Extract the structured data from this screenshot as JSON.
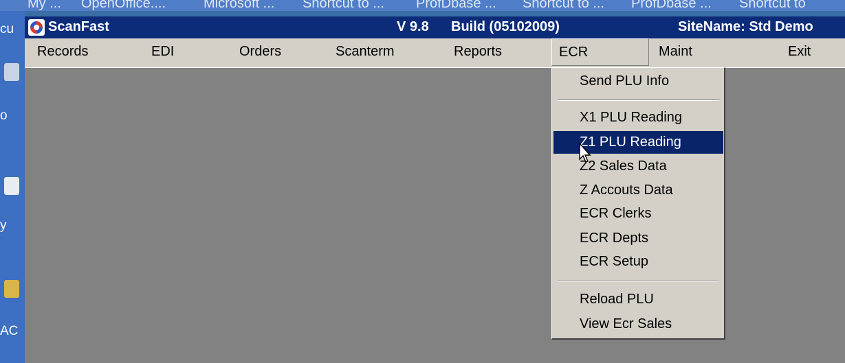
{
  "desktop": {
    "top_labels": [
      "My ...",
      "OpenOffice....",
      "Microsoft ...",
      "Shortcut to ...",
      "ProfDbase ...",
      "Shortcut to ...",
      "ProfDbase ...",
      "Shortcut to"
    ],
    "left_labels": [
      "cu",
      "o",
      "y",
      "AC"
    ]
  },
  "window": {
    "app_title": "ScanFast",
    "version": "V 9.8",
    "build": "Build (05102009)",
    "site_name": "SiteName: Std Demo"
  },
  "menubar": {
    "items": [
      "Records",
      "EDI",
      "Orders",
      "Scanterm",
      "Reports",
      "ECR",
      "Maint",
      "Exit"
    ],
    "active": "ECR"
  },
  "ecr_menu": {
    "groups": [
      [
        "Send PLU Info"
      ],
      [
        "X1 PLU Reading",
        "Z1 PLU Reading",
        "Z2 Sales Data",
        "Z Accouts Data",
        "ECR Clerks",
        "ECR Depts",
        "ECR Setup"
      ],
      [
        "Reload PLU",
        "View Ecr Sales"
      ]
    ],
    "highlighted": "Z1 PLU Reading"
  },
  "colors": {
    "titlebar": "#0c2c7a",
    "menu_bg": "#d4d0c8",
    "client_bg": "#828282",
    "highlight": "#0a246a"
  }
}
